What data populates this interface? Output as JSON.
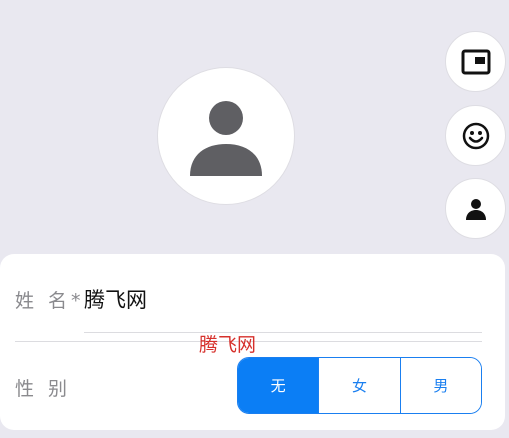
{
  "profile": {
    "avatar_icon": "person-icon"
  },
  "side_actions": [
    {
      "icon": "picture-in-picture-icon"
    },
    {
      "icon": "smiley-icon"
    },
    {
      "icon": "person-icon"
    }
  ],
  "form": {
    "name_label": "姓 名*",
    "name_value": "腾飞网",
    "watermark": "腾飞网",
    "gender_label": "性 别",
    "gender_options": [
      "无",
      "女",
      "男"
    ],
    "gender_selected": "无"
  },
  "colors": {
    "accent": "#0b7ef5",
    "watermark": "#d6302b",
    "background": "#e9e8f0"
  }
}
